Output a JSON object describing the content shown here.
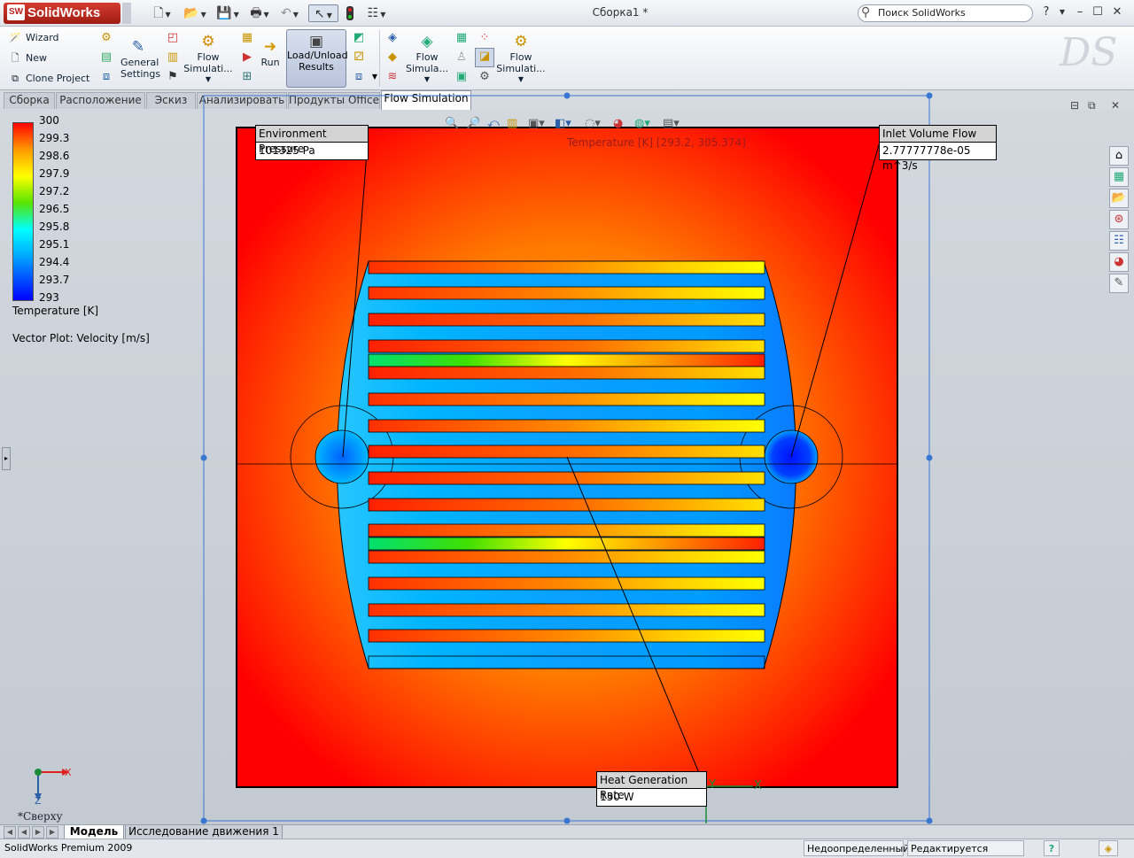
{
  "app": {
    "logo_text": "SolidWorks",
    "window_title": "Сборка1 *",
    "search_placeholder": "Поиск SolidWorks"
  },
  "quick_access": {
    "new_icon": "new-document-icon",
    "open_icon": "open-folder-icon",
    "save_icon": "save-icon",
    "print_icon": "print-icon",
    "undo_icon": "undo-icon",
    "select_icon": "select-cursor-icon",
    "rebuild_icon": "rebuild-traffic-light-icon",
    "options_icon": "file-properties-icon"
  },
  "command_manager": {
    "project_items": [
      "Wizard",
      "New",
      "Clone Project"
    ],
    "general_settings": "General Settings",
    "flow_simulation_1": "Flow Simulati...",
    "run": "Run",
    "load_unload": "Load/Unload Results",
    "flow_simulation_2": "Flow Simula...",
    "flow_simulation_3": "Flow Simulati..."
  },
  "tabs": [
    "Сборка",
    "Расположение",
    "Эскиз",
    "Анализировать",
    "Продукты Office",
    "Flow Simulation"
  ],
  "active_tab": "Flow Simulation",
  "legend": {
    "values": [
      "300",
      "299.3",
      "298.6",
      "297.9",
      "297.2",
      "296.5",
      "295.8",
      "295.1",
      "294.4",
      "293.7",
      "293"
    ],
    "title": "Temperature [K]",
    "vector_title": "Vector Plot: Velocity [m/s]",
    "colors": {
      "max": "#ff0000",
      "mid": "#ffff00",
      "low": "#00ffff",
      "min": "#0000ff"
    }
  },
  "plot": {
    "range_label": "Temperature [K] [293.2, 305.374]"
  },
  "callouts": {
    "environment_pressure": {
      "label": "Environment Pressure",
      "value": "101325 Pa"
    },
    "inlet_volume_flow": {
      "label": "Inlet Volume Flow",
      "value": "2.77777778e-05 m^3/s"
    },
    "heat_generation_rate": {
      "label": "Heat Generation Rate",
      "value": "150 W"
    }
  },
  "triad": {
    "x": "X",
    "z": "Z",
    "view_name": "*Сверху"
  },
  "bottom_tabs": [
    "Модель",
    "Исследование движения 1"
  ],
  "status_bar": {
    "product": "SolidWorks Premium 2009",
    "state": "Недоопределенный",
    "editing": "Редактируется Сборка",
    "help": "?"
  }
}
